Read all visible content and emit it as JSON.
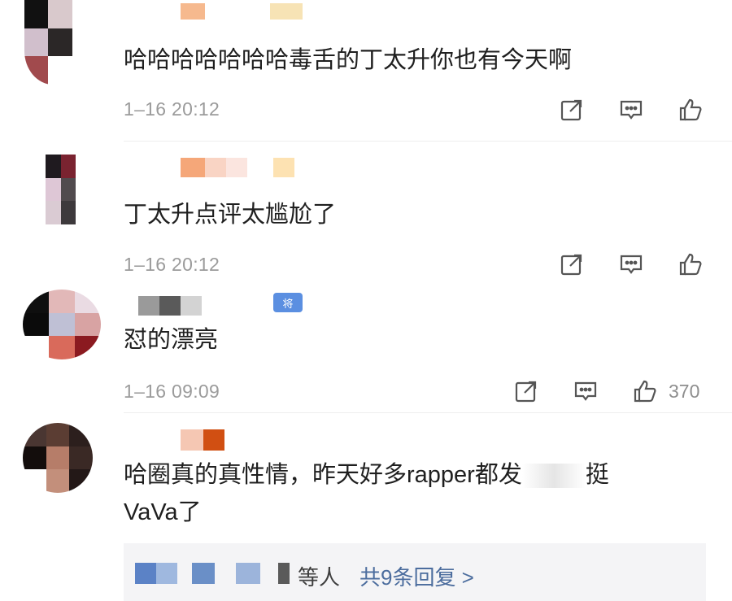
{
  "comments": [
    {
      "text": "哈哈哈哈哈哈哈毒舌的丁太升你也有今天啊",
      "time": "1–16 20:12",
      "likes": ""
    },
    {
      "text": "丁太升点评太尴尬了",
      "time": "1–16 20:12",
      "likes": ""
    },
    {
      "text": "怼的漂亮",
      "time": "1–16 09:09",
      "likes": "370",
      "badge": "将"
    },
    {
      "text_line1": "哈圈真的真性情，昨天好多rapper都发",
      "text_line1b": "挺",
      "text_line2": "VaVa了",
      "time": ""
    }
  ],
  "reply_summary": {
    "suffix": "等人",
    "link": "共9条回复 >"
  },
  "icons": {
    "share": "share-icon",
    "comment": "comment-icon",
    "like": "thumbs-up-icon"
  },
  "colors": {
    "link": "#4c6d9e",
    "meta": "#9b9b9b",
    "badge": "#5b8fe1"
  }
}
